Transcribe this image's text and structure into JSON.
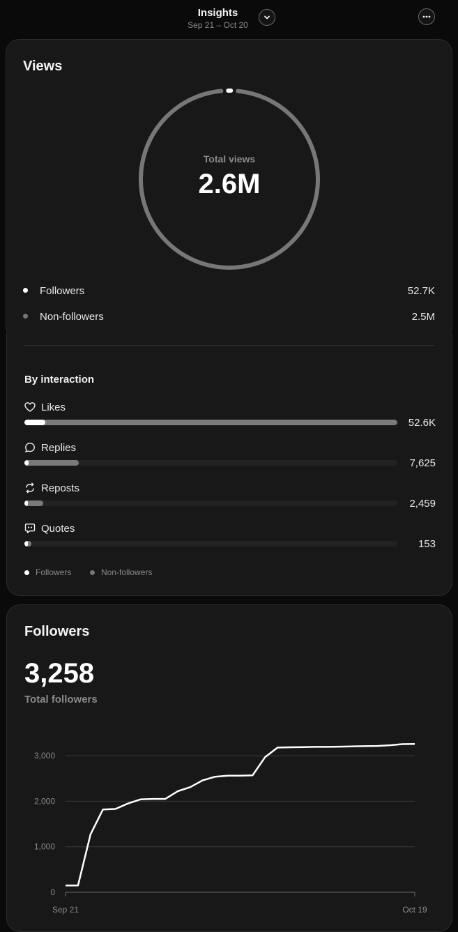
{
  "header": {
    "title": "Insights",
    "date_range": "Sep 21 – Oct 20"
  },
  "views": {
    "title": "Views",
    "center_label": "Total views",
    "total": "2.6M",
    "followers_share": 0.02,
    "legend": [
      {
        "label": "Followers",
        "value": "52.7K",
        "color": "#ffffff"
      },
      {
        "label": "Non-followers",
        "value": "2.5M",
        "color": "#7a7a7a"
      }
    ]
  },
  "interaction": {
    "title": "By interaction",
    "items": [
      {
        "label": "Likes",
        "value": "52.6K",
        "icon": "heart-icon",
        "total_frac": 1.0,
        "followers_frac": 0.056
      },
      {
        "label": "Replies",
        "value": "7,625",
        "icon": "reply-icon",
        "total_frac": 0.145,
        "followers_frac": 0.011
      },
      {
        "label": "Reposts",
        "value": "2,459",
        "icon": "repost-icon",
        "total_frac": 0.05,
        "followers_frac": 0.005
      },
      {
        "label": "Quotes",
        "value": "153",
        "icon": "quote-icon",
        "total_frac": 0.018,
        "followers_frac": 0.004
      }
    ],
    "legend": [
      {
        "label": "Followers",
        "color": "#ffffff"
      },
      {
        "label": "Non-followers",
        "color": "#7a7a7a"
      }
    ]
  },
  "followers": {
    "title": "Followers",
    "total": "3,258",
    "total_label": "Total followers"
  },
  "chart_data": {
    "type": "line",
    "x_start_label": "Sep 21",
    "x_end_label": "Oct 19",
    "y_ticks": [
      "0",
      "1,000",
      "2,000",
      "3,000"
    ],
    "ylim": [
      0,
      3400
    ],
    "grid": true,
    "series": [
      {
        "values": [
          150,
          150,
          1270,
          1820,
          1830,
          1950,
          2040,
          2050,
          2050,
          2220,
          2310,
          2460,
          2540,
          2560,
          2560,
          2570,
          2970,
          3180,
          3185,
          3190,
          3195,
          3195,
          3200,
          3205,
          3210,
          3215,
          3230,
          3255,
          3258
        ]
      }
    ]
  }
}
